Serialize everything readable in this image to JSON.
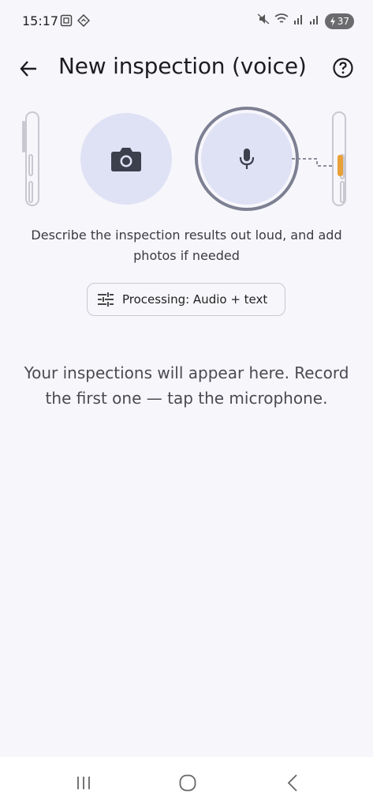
{
  "status_bar": {
    "time": "15:17",
    "battery": "37",
    "icons": [
      "screenshot-icon",
      "location-icon",
      "mute-icon",
      "wifi-icon",
      "signal-r-icon",
      "signal-icon",
      "battery-icon"
    ]
  },
  "app_bar": {
    "title": "New inspection (voice)",
    "back_icon": "arrow-back-icon",
    "help_icon": "help-circle-icon"
  },
  "illustration": {
    "camera_icon": "camera-icon",
    "mic_icon": "microphone-icon",
    "accent_color": "#e8a037",
    "circle_color": "#dfe2f5"
  },
  "instructions": "Describe the inspection results out loud, and add photos if needed",
  "processing_chip": {
    "label": "Processing: Audio + text",
    "icon": "tune-icon"
  },
  "empty_state": "Your inspections will appear here. Record the first one — tap the microphone.",
  "nav_bar": {
    "recents_icon": "recents-icon",
    "home_icon": "home-icon",
    "back_icon": "nav-back-icon"
  }
}
